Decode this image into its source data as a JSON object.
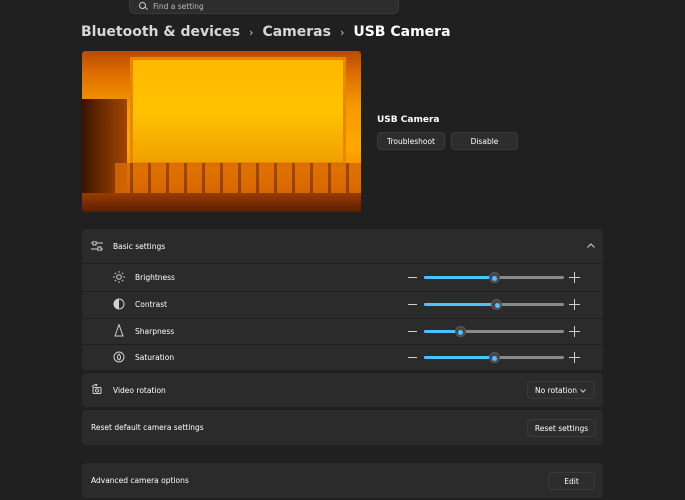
{
  "search": {
    "placeholder": "Find a setting"
  },
  "breadcrumb": {
    "items": [
      "Bluetooth & devices",
      "Cameras",
      "USB Camera"
    ]
  },
  "camera": {
    "name": "USB Camera",
    "troubleshoot_label": "Troubleshoot",
    "disable_label": "Disable"
  },
  "basic_settings": {
    "title": "Basic settings",
    "sliders": [
      {
        "label": "Brightness",
        "icon": "sun-icon",
        "value_fraction": 0.5
      },
      {
        "label": "Contrast",
        "icon": "contrast-icon",
        "value_fraction": 0.52
      },
      {
        "label": "Sharpness",
        "icon": "sharpness-icon",
        "value_fraction": 0.26
      },
      {
        "label": "Saturation",
        "icon": "saturation-icon",
        "value_fraction": 0.5
      }
    ]
  },
  "video_rotation": {
    "label": "Video rotation",
    "selected": "No rotation"
  },
  "reset": {
    "label": "Reset default camera settings",
    "button_label": "Reset settings"
  },
  "advanced": {
    "label": "Advanced camera options",
    "button_label": "Edit"
  },
  "colors": {
    "accent": "#4cc2ff",
    "background": "#202020",
    "card": "#2b2b2b"
  }
}
